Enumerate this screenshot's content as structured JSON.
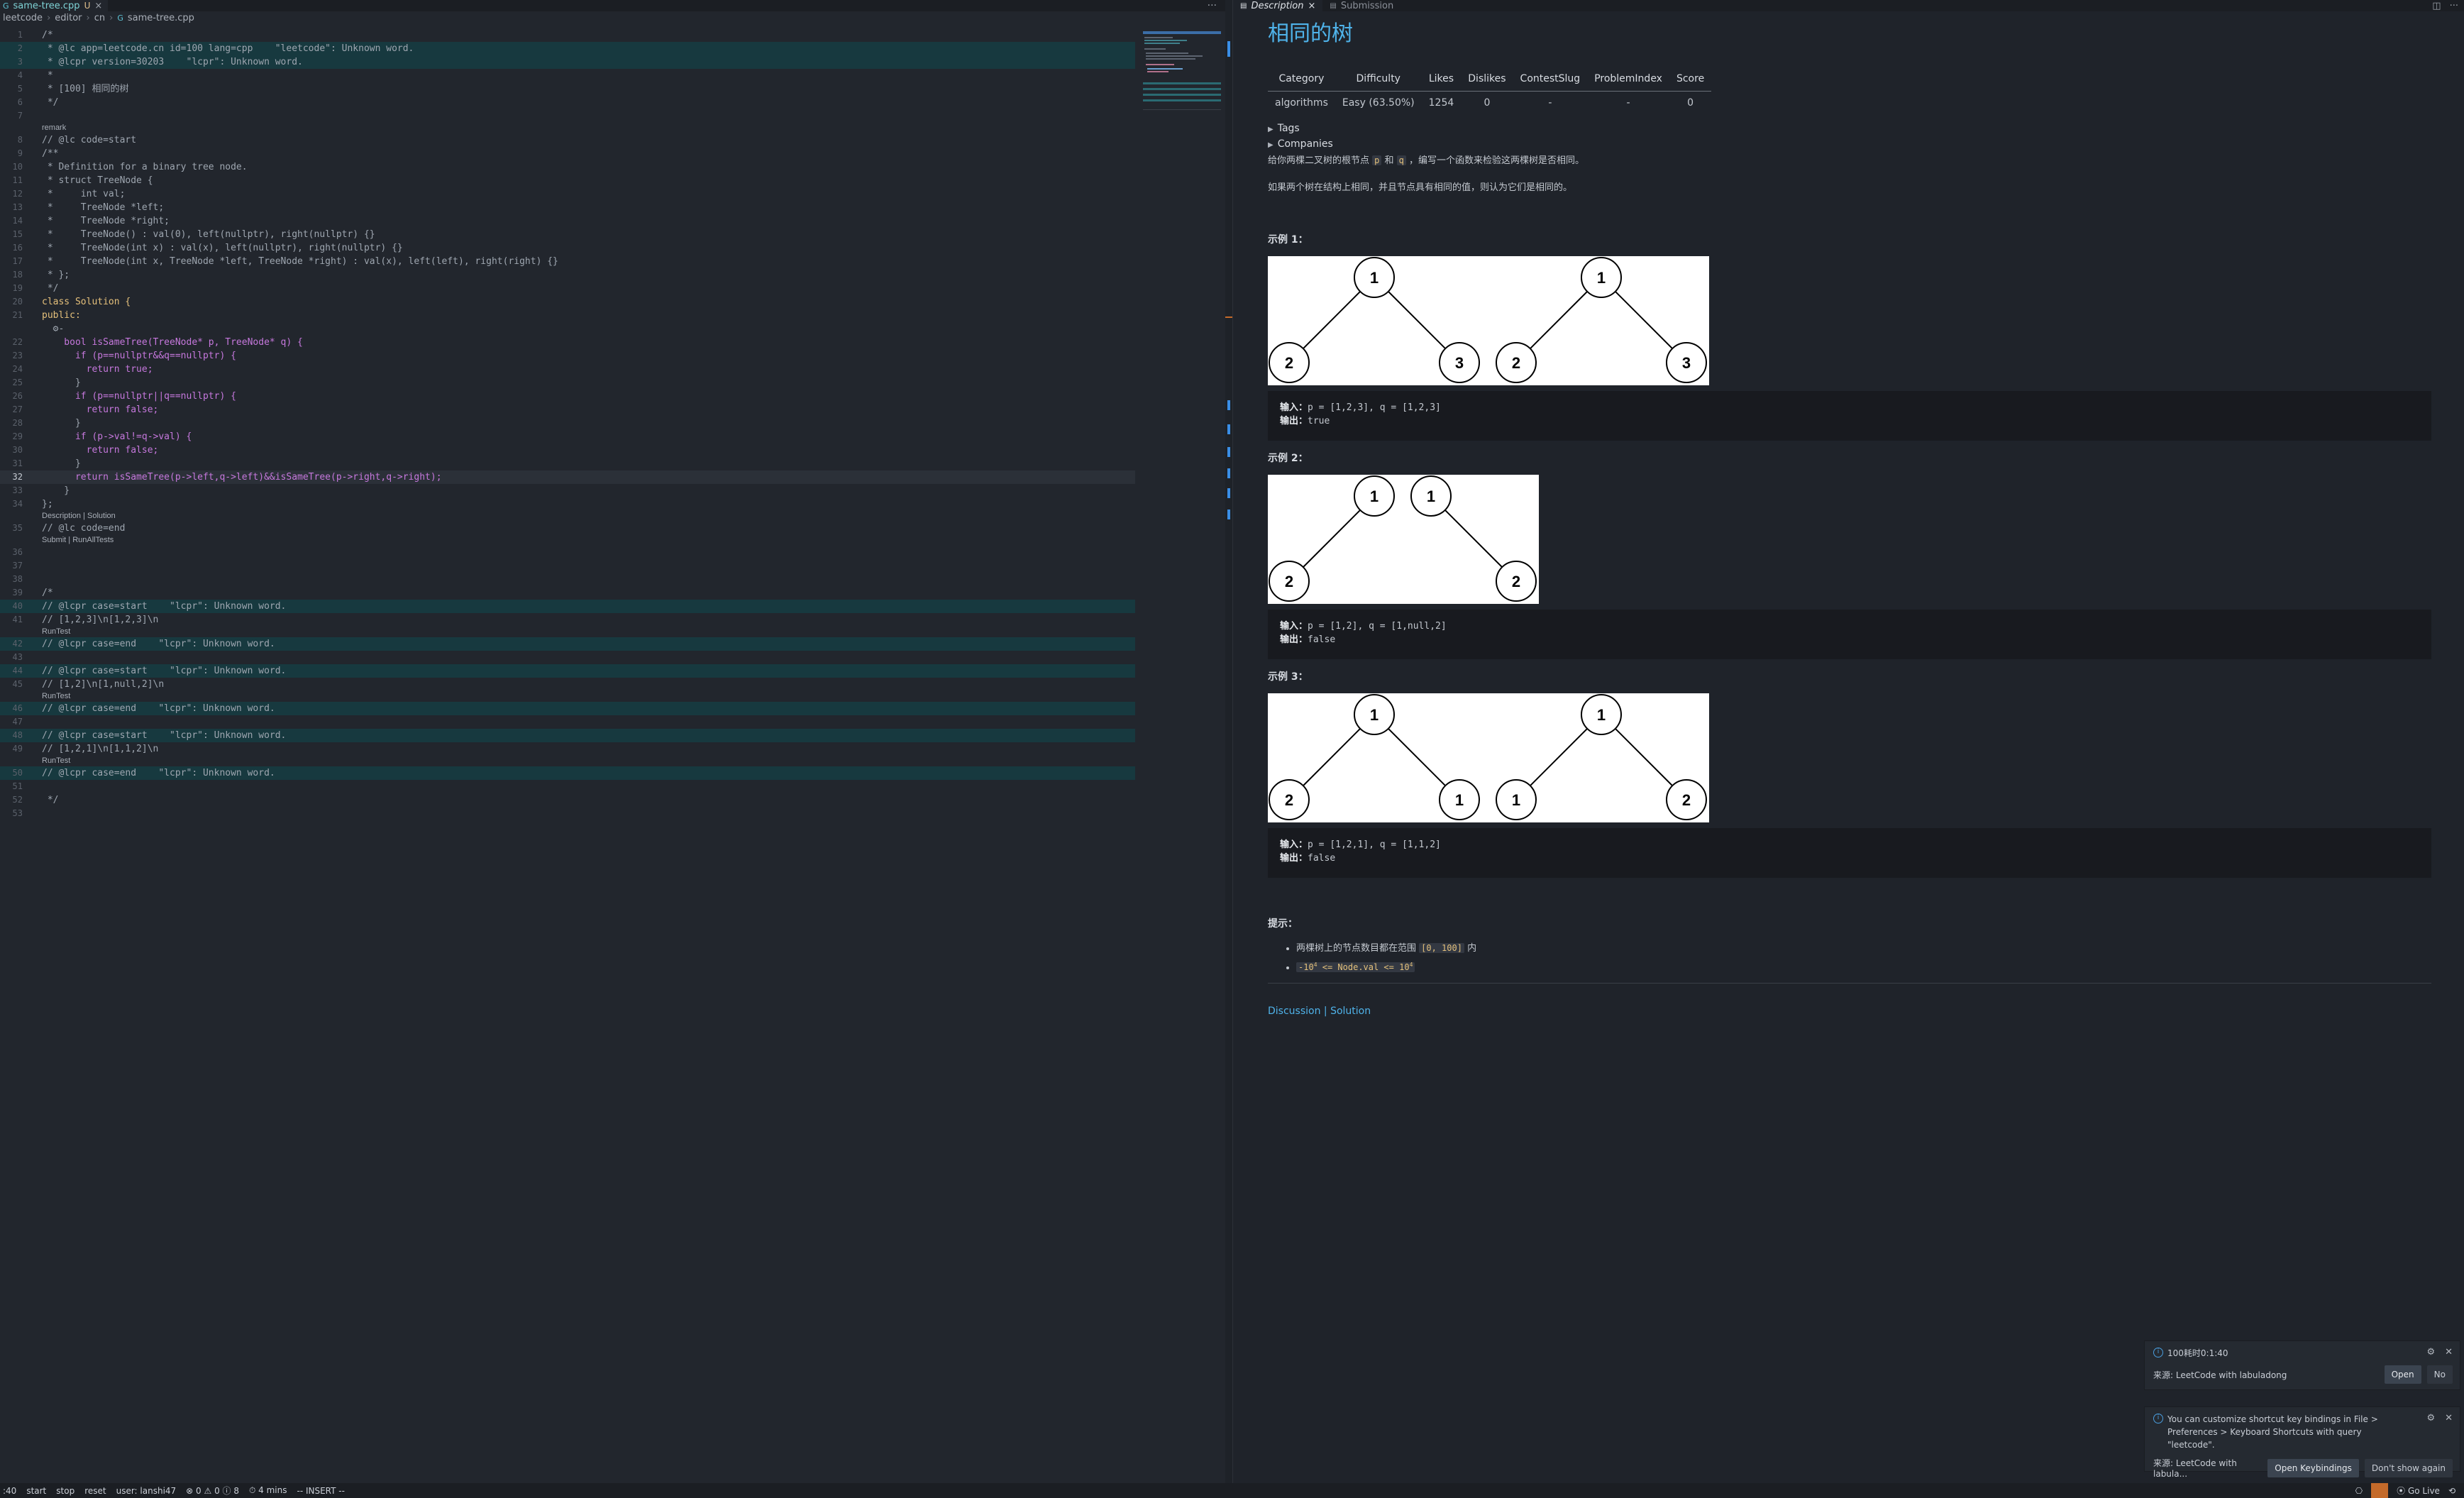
{
  "editor": {
    "tab": {
      "icon": "c++-icon",
      "filename": "same-tree.cpp",
      "modified_flag": "U",
      "close": "×"
    },
    "more_actions": "···",
    "breadcrumb": [
      "leetcode",
      "editor",
      "cn",
      "same-tree.cpp"
    ],
    "lines": [
      {
        "n": "1",
        "t": "/*"
      },
      {
        "n": "2",
        "t": " * @lc app=leetcode.cn id=100 lang=cpp    \"leetcode\": Unknown word."
      },
      {
        "n": "3",
        "t": " * @lcpr version=30203    \"lcpr\": Unknown word."
      },
      {
        "n": "4",
        "t": " *"
      },
      {
        "n": "5",
        "t": " * [100] 相同的树"
      },
      {
        "n": "6",
        "t": " */"
      },
      {
        "n": "7",
        "t": ""
      },
      {
        "lens": "remark"
      },
      {
        "n": "8",
        "t": "// @lc code=start"
      },
      {
        "n": "9",
        "t": "/**"
      },
      {
        "n": "10",
        "t": " * Definition for a binary tree node."
      },
      {
        "n": "11",
        "t": " * struct TreeNode {"
      },
      {
        "n": "12",
        "t": " *     int val;"
      },
      {
        "n": "13",
        "t": " *     TreeNode *left;"
      },
      {
        "n": "14",
        "t": " *     TreeNode *right;"
      },
      {
        "n": "15",
        "t": " *     TreeNode() : val(0), left(nullptr), right(nullptr) {}"
      },
      {
        "n": "16",
        "t": " *     TreeNode(int x) : val(x), left(nullptr), right(nullptr) {}"
      },
      {
        "n": "17",
        "t": " *     TreeNode(int x, TreeNode *left, TreeNode *right) : val(x), left(left), right(right) {}"
      },
      {
        "n": "18",
        "t": " * };"
      },
      {
        "n": "19",
        "t": " */"
      },
      {
        "n": "20",
        "t": "class Solution {"
      },
      {
        "n": "21",
        "t": "public:"
      },
      {
        "n": "",
        "t": "  ⚙-"
      },
      {
        "n": "22",
        "t": "    bool isSameTree(TreeNode* p, TreeNode* q) {"
      },
      {
        "n": "23",
        "t": "      if (p==nullptr&&q==nullptr) {"
      },
      {
        "n": "24",
        "t": "        return true;"
      },
      {
        "n": "25",
        "t": "      }"
      },
      {
        "n": "26",
        "t": "      if (p==nullptr||q==nullptr) {"
      },
      {
        "n": "27",
        "t": "        return false;"
      },
      {
        "n": "28",
        "t": "      }"
      },
      {
        "n": "29",
        "t": "      if (p->val!=q->val) {"
      },
      {
        "n": "30",
        "t": "        return false;"
      },
      {
        "n": "31",
        "t": "      }"
      },
      {
        "n": "32",
        "t": "      return isSameTree(p->left,q->left)&&isSameTree(p->right,q->right);"
      },
      {
        "n": "33",
        "t": "    }"
      },
      {
        "n": "34",
        "t": "};"
      },
      {
        "lens": "Description | Solution"
      },
      {
        "n": "35",
        "t": "// @lc code=end"
      },
      {
        "lens": "Submit | RunAllTests"
      },
      {
        "n": "36",
        "t": ""
      },
      {
        "n": "37",
        "t": ""
      },
      {
        "n": "38",
        "t": ""
      },
      {
        "n": "39",
        "t": "/*"
      },
      {
        "n": "40",
        "t": "// @lcpr case=start    \"lcpr\": Unknown word."
      },
      {
        "n": "41",
        "t": "// [1,2,3]\\n[1,2,3]\\n"
      },
      {
        "lens": "RunTest"
      },
      {
        "n": "42",
        "t": "// @lcpr case=end    \"lcpr\": Unknown word."
      },
      {
        "n": "43",
        "t": ""
      },
      {
        "n": "44",
        "t": "// @lcpr case=start    \"lcpr\": Unknown word."
      },
      {
        "n": "45",
        "t": "// [1,2]\\n[1,null,2]\\n"
      },
      {
        "lens": "RunTest"
      },
      {
        "n": "46",
        "t": "// @lcpr case=end    \"lcpr\": Unknown word."
      },
      {
        "n": "47",
        "t": ""
      },
      {
        "n": "48",
        "t": "// @lcpr case=start    \"lcpr\": Unknown word."
      },
      {
        "n": "49",
        "t": "// [1,2,1]\\n[1,1,2]\\n"
      },
      {
        "lens": "RunTest"
      },
      {
        "n": "50",
        "t": "// @lcpr case=end    \"lcpr\": Unknown word."
      },
      {
        "n": "51",
        "t": ""
      },
      {
        "n": "52",
        "t": " */"
      },
      {
        "n": "53",
        "t": ""
      }
    ]
  },
  "panel": {
    "tabs": [
      {
        "label": "Description",
        "close": "×"
      },
      {
        "label": "Submission"
      }
    ],
    "title": "相同的树",
    "meta_headers": [
      "Category",
      "Difficulty",
      "Likes",
      "Dislikes",
      "ContestSlug",
      "ProblemIndex",
      "Score"
    ],
    "meta_values": [
      "algorithms",
      "Easy (63.50%)",
      "1254",
      "0",
      "-",
      "-",
      "0"
    ],
    "tags_label": "Tags",
    "companies_label": "Companies",
    "desc1_pre": "给你两棵二叉树的根节点 ",
    "desc1_p": "p",
    "desc1_and": " 和 ",
    "desc1_q": "q",
    "desc1_post": " ，编写一个函数来检验这两棵树是否相同。",
    "desc2": "如果两个树在结构上相同，并且节点具有相同的值，则认为它们是相同的。",
    "examples": [
      {
        "title": "示例 1：",
        "input_label": "输入：",
        "input": "p = [1,2,3], q = [1,2,3]",
        "output_label": "输出：",
        "output": "true",
        "left_nodes": [
          "1",
          "2",
          "3"
        ],
        "right_nodes": [
          "1",
          "2",
          "3"
        ]
      },
      {
        "title": "示例 2：",
        "input_label": "输入：",
        "input": "p = [1,2], q = [1,null,2]",
        "output_label": "输出：",
        "output": "false",
        "left_nodes": [
          "1",
          "2"
        ],
        "right_nodes": [
          "1",
          "2"
        ]
      },
      {
        "title": "示例 3：",
        "input_label": "输入：",
        "input": "p = [1,2,1], q = [1,1,2]",
        "output_label": "输出：",
        "output": "false",
        "left_nodes": [
          "1",
          "2",
          "1"
        ],
        "right_nodes": [
          "1",
          "1",
          "2"
        ]
      }
    ],
    "hints_title": "提示：",
    "hint1_pre": "两棵树上的节点数目都在范围 ",
    "hint1_code": "[0, 100]",
    "hint1_post": " 内",
    "hint2_a": "-10",
    "hint2_exp1": "4",
    "hint2_b": " <= Node.val <= 10",
    "hint2_exp2": "4",
    "footer_discussion": "Discussion",
    "footer_sep": " | ",
    "footer_solution": "Solution"
  },
  "notifications": [
    {
      "message": "100耗时0:1:40",
      "source": "来源: LeetCode with labuladong",
      "buttons": [
        "Open",
        "No"
      ]
    },
    {
      "message": "You can customize shortcut key bindings in File > Preferences > Keyboard Shortcuts with query \"leetcode\".",
      "source": "来源: LeetCode with labula...",
      "buttons": [
        "Open Keybindings",
        "Don't show again"
      ]
    }
  ],
  "statusbar": {
    "items": [
      ":40",
      "start",
      "stop",
      "reset",
      "user: lanshi47",
      "⊗ 0 ⚠ 0 ⓘ 8",
      "⏱ 4 mins",
      "-- INSERT --"
    ],
    "go_live": "Go Live"
  },
  "colors": {
    "accent": "#4fb3ea",
    "highlight_line": "#17393f",
    "remote": "#c46a2a"
  }
}
